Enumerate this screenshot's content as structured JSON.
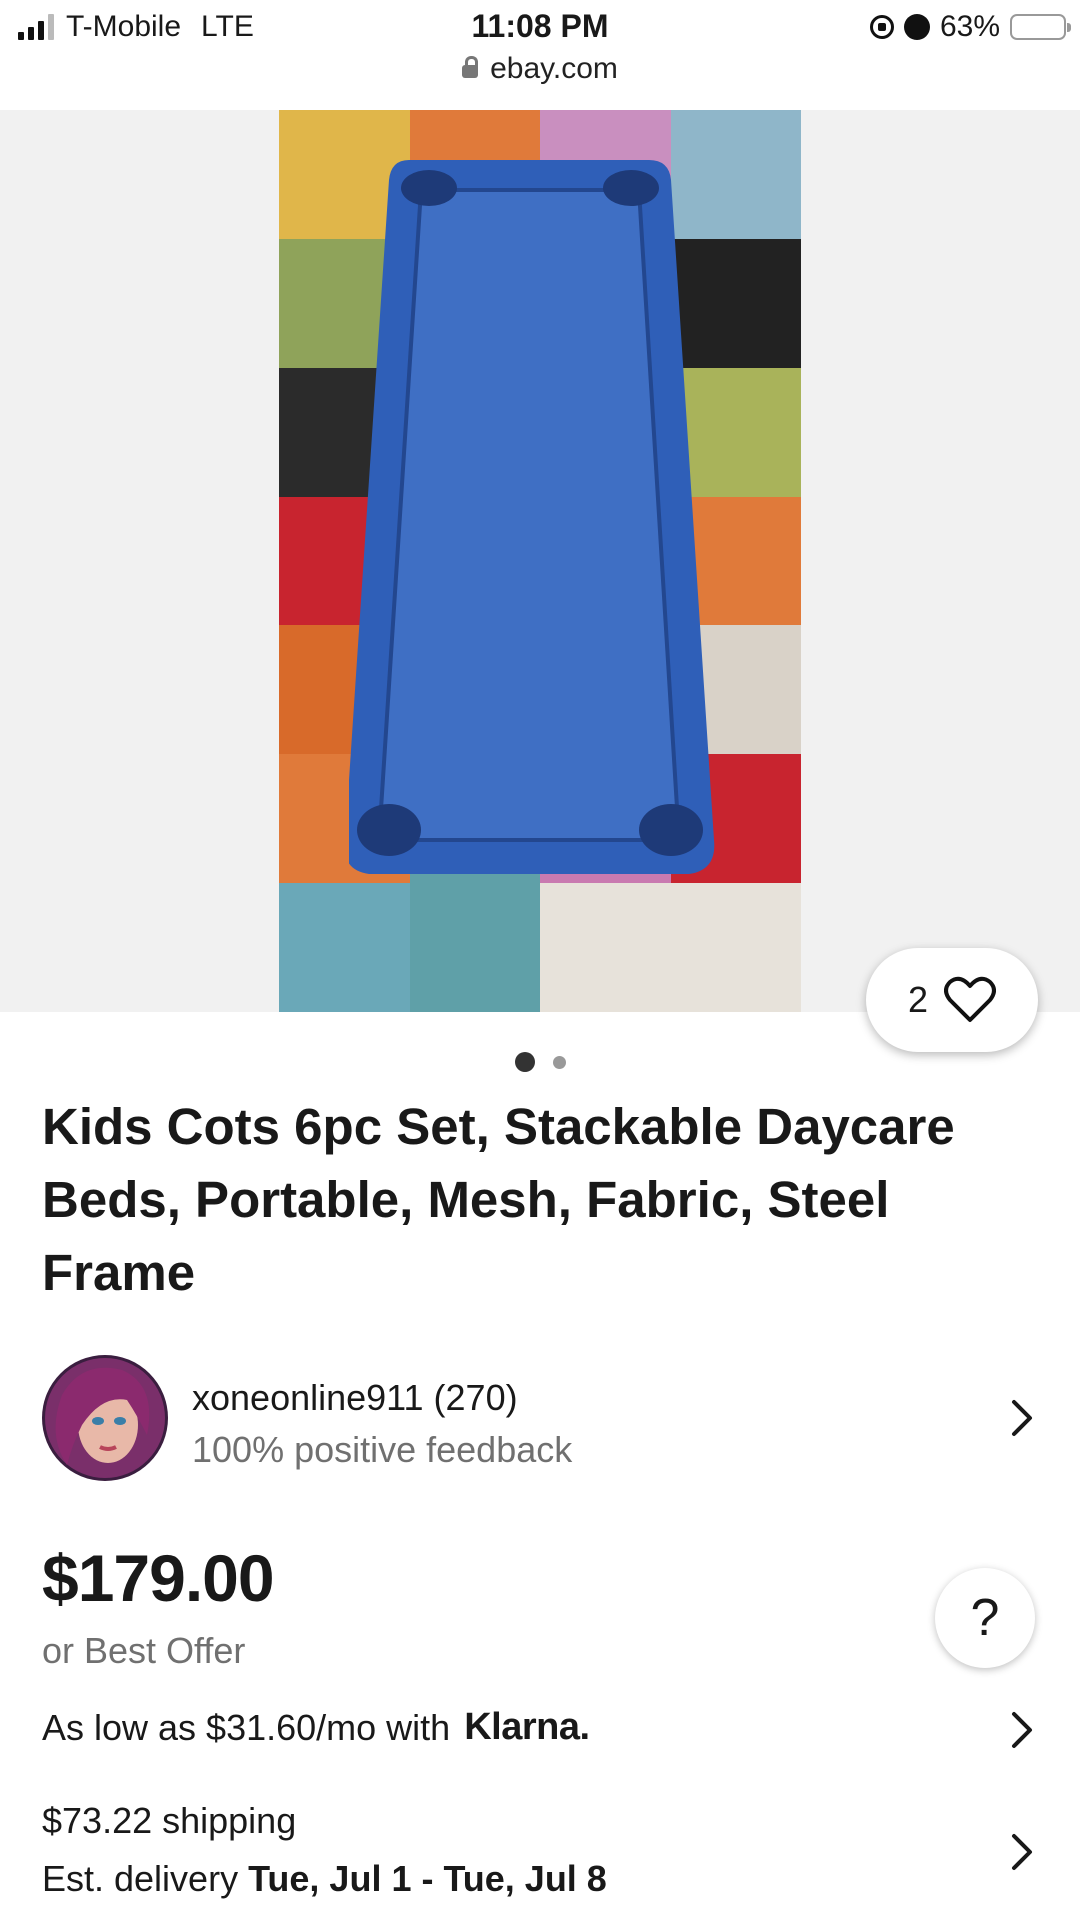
{
  "status": {
    "carrier": "T-Mobile",
    "network": "LTE",
    "time": "11:08 PM",
    "url": "ebay.com",
    "battery": "63%",
    "battery_level": 0.63,
    "battery_color": "#f5c518"
  },
  "gallery": {
    "favorite_count": "2",
    "favorite_icon": "heart-outline-icon",
    "image_count": 2,
    "active_index": 0
  },
  "listing": {
    "title": "Kids Cots 6pc Set, Stackable Daycare Beds, Portable, Mesh, Fabric, Steel Frame"
  },
  "seller": {
    "name": "xoneonline911 (270)",
    "feedback": "100% positive feedback"
  },
  "pricing": {
    "price": "$179.00",
    "best_offer": "or Best Offer",
    "klarna_text": "As low as $31.60/mo with",
    "klarna_brand": "Klarna.",
    "shipping": "$73.22 shipping",
    "delivery_prefix": "Est. delivery",
    "delivery_dates": "Tue, Jul 1 - Tue, Jul 8"
  },
  "help_label": "?"
}
